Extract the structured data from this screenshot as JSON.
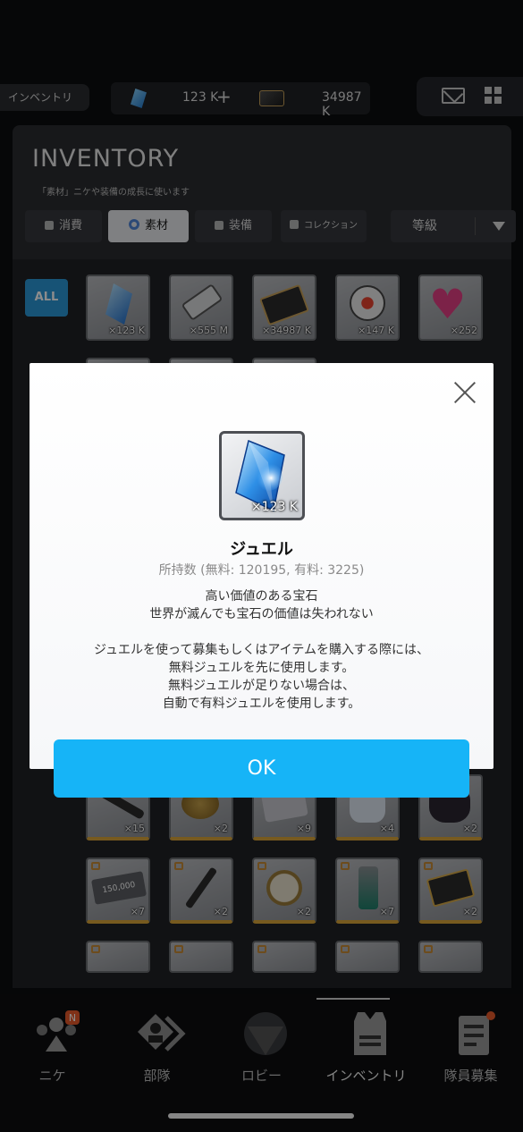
{
  "topbar": {
    "section_tag": "インベントリ",
    "gem_amount": "123 K",
    "gem_plus": "+",
    "credit_amount": "34987 K"
  },
  "inventory": {
    "title": "INVENTORY",
    "subtitle": "「素材」ニケや装備の成長に使います",
    "tabs": [
      {
        "label": "消費",
        "active": false
      },
      {
        "label": "素材",
        "active": true
      },
      {
        "label": "装備",
        "active": false
      },
      {
        "label": "コレクション",
        "active": false
      }
    ],
    "sort_label": "等級",
    "filter_all": "ALL",
    "row1_items": [
      {
        "icon": "jewel-icon",
        "qty": "×123 K"
      },
      {
        "icon": "usb-drive-icon",
        "qty": "×555 M"
      },
      {
        "icon": "credit-card-icon",
        "qty": "×34987 K"
      },
      {
        "icon": "robot-eye-icon",
        "qty": "×147 K"
      },
      {
        "icon": "heart-gem-icon",
        "qty": "×252"
      }
    ],
    "row2_items": [
      {
        "icon": "baton-icon",
        "qty": "×15"
      },
      {
        "icon": "bottle-cap-icon",
        "qty": "×2"
      },
      {
        "icon": "cloth-icon",
        "qty": "×9"
      },
      {
        "icon": "plush-toy-icon",
        "qty": "×4"
      },
      {
        "icon": "figure-icon",
        "qty": "×2"
      }
    ],
    "row3_items": [
      {
        "icon": "ticket-icon",
        "qty": "×7",
        "label": "150,000"
      },
      {
        "icon": "wrench-icon",
        "qty": "×2"
      },
      {
        "icon": "compass-icon",
        "qty": "×2"
      },
      {
        "icon": "energy-can-icon",
        "qty": "×7"
      },
      {
        "icon": "gold-card-icon",
        "qty": "×2"
      }
    ]
  },
  "dialog": {
    "item_qty": "×123 K",
    "title": "ジュエル",
    "count": "所持数 (無料: 120195, 有料: 3225)",
    "desc_lines_1": [
      "高い価値のある宝石",
      "世界が滅んでも宝石の価値は失われない"
    ],
    "desc_lines_2": [
      "ジュエルを使って募集もしくはアイテムを購入する際には、",
      "無料ジュエルを先に使用します。",
      "無料ジュエルが足りない場合は、",
      "自動で有料ジュエルを使用します。"
    ],
    "ok_label": "OK"
  },
  "nav": {
    "items": [
      {
        "label": "ニケ",
        "badge": "N"
      },
      {
        "label": "部隊"
      },
      {
        "label": "ロビー"
      },
      {
        "label": "インベントリ",
        "active": true
      },
      {
        "label": "隊員募集"
      }
    ]
  },
  "colors": {
    "ok_button": "#16b4f7",
    "all_button": "#2b97d8",
    "badge": "#e85a2a"
  }
}
